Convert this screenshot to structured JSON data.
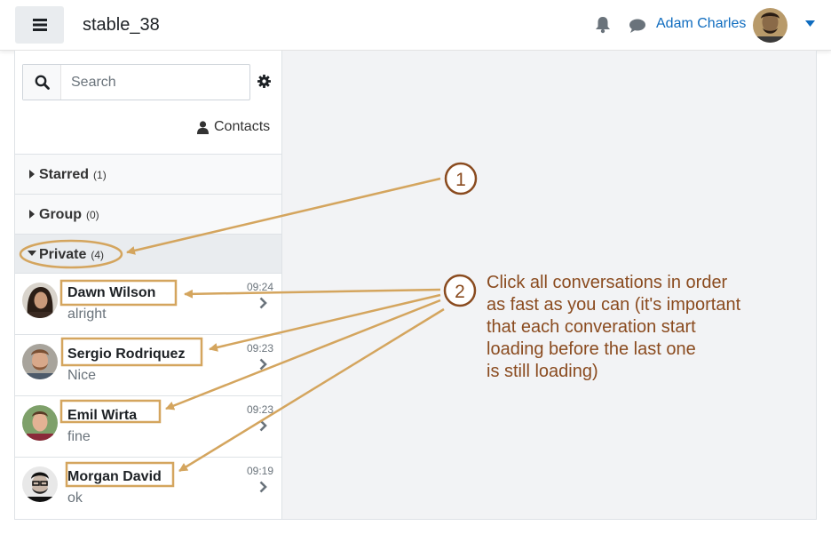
{
  "navbar": {
    "site_name": "stable_38",
    "user_name": "Adam Charles",
    "icons": [
      "menu-icon",
      "bell-icon",
      "chat-icon",
      "chevron-down-icon"
    ]
  },
  "drawer": {
    "search_placeholder": "Search",
    "contacts_label": "Contacts",
    "sections": {
      "starred": {
        "label": "Starred",
        "count": "(1)"
      },
      "group": {
        "label": "Group",
        "count": "(0)"
      },
      "private": {
        "label": "Private",
        "count": "(4)"
      }
    },
    "conversations": [
      {
        "name": "Dawn Wilson",
        "preview": "alright",
        "time": "09:24"
      },
      {
        "name": "Sergio Rodriquez",
        "preview": "Nice",
        "time": "09:23"
      },
      {
        "name": "Emil Wirta",
        "preview": "fine",
        "time": "09:23"
      },
      {
        "name": "Morgan David",
        "preview": "ok",
        "time": "09:19"
      }
    ]
  },
  "annotations": {
    "marker_1": "1",
    "marker_2": "2",
    "note_lines": [
      "Click all conversations in order",
      "as fast as you can (it's important",
      "that each converation start",
      "loading before the last one",
      "is still loading)"
    ],
    "color": "#d4a55e"
  }
}
